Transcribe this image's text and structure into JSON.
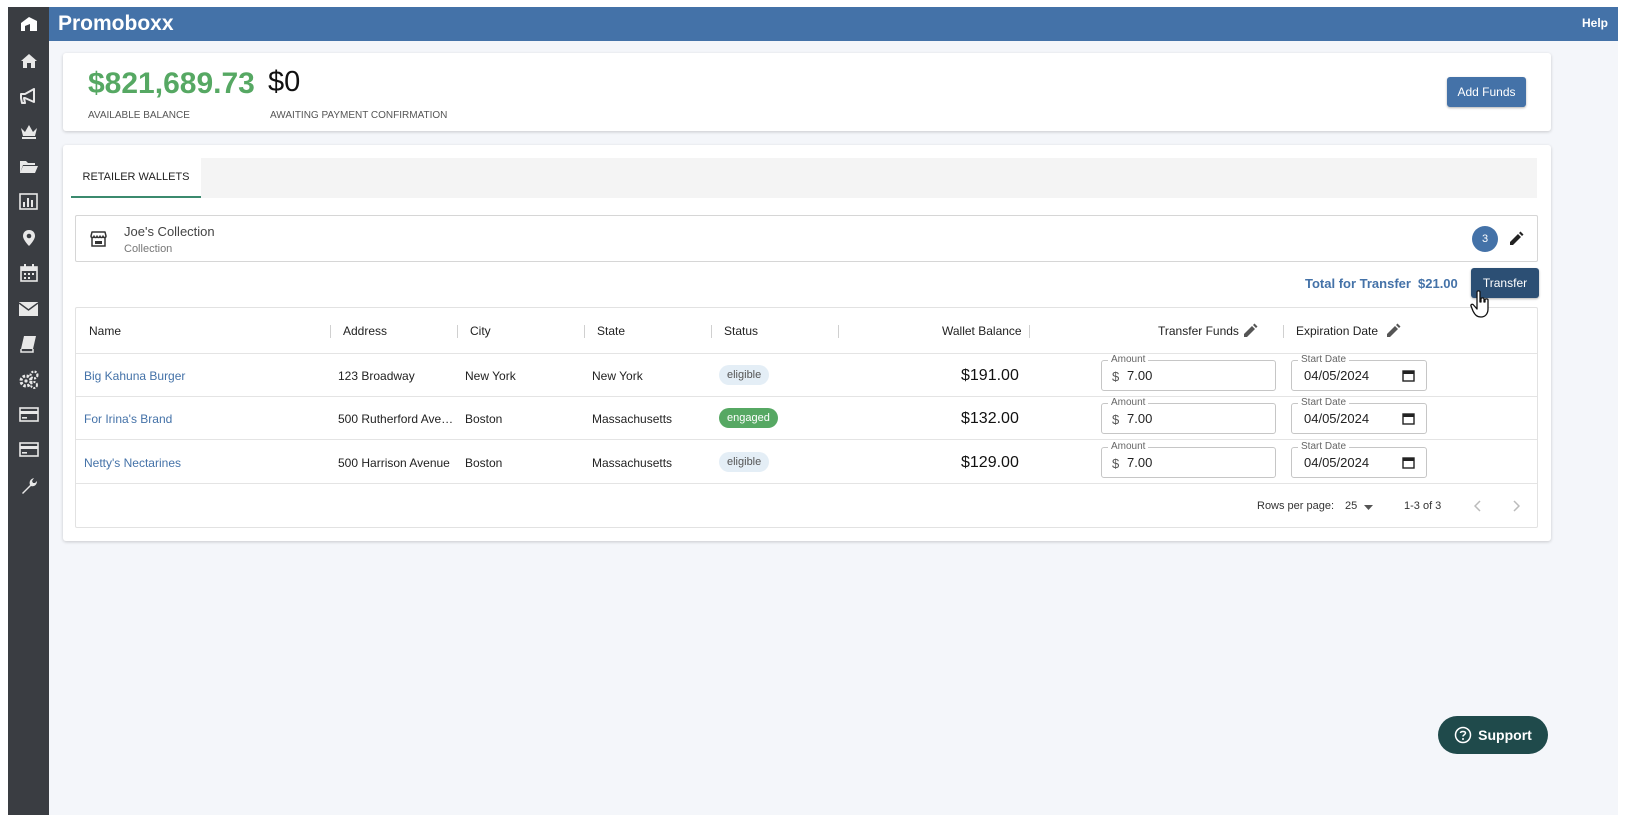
{
  "app": {
    "title": "Promoboxx",
    "help_label": "Help"
  },
  "sidebar": {
    "items": [
      {
        "icon": "home-icon"
      },
      {
        "icon": "megaphone-icon"
      },
      {
        "icon": "crown-icon"
      },
      {
        "icon": "folder-icon"
      },
      {
        "icon": "chart-icon"
      },
      {
        "icon": "map-pin-icon"
      },
      {
        "icon": "calendar-icon"
      },
      {
        "icon": "mail-icon"
      },
      {
        "icon": "book-icon"
      },
      {
        "icon": "gears-icon"
      },
      {
        "icon": "card-icon"
      },
      {
        "icon": "card-icon"
      },
      {
        "icon": "wrench-icon"
      }
    ]
  },
  "balance": {
    "available_amount": "$821,689.73",
    "available_label": "AVAILABLE BALANCE",
    "awaiting_amount": "$0",
    "awaiting_label": "AWAITING PAYMENT CONFIRMATION",
    "add_funds_label": "Add Funds"
  },
  "tabs": [
    {
      "label": "RETAILER WALLETS",
      "active": true
    }
  ],
  "retailer": {
    "name": "Joe's Collection",
    "type": "Collection",
    "count": "3"
  },
  "transfer": {
    "total_label": "Total for Transfer",
    "total_value": "$21.00",
    "button_label": "Transfer"
  },
  "table": {
    "columns": [
      "Name",
      "Address",
      "City",
      "State",
      "Status",
      "Wallet Balance",
      "Transfer Funds",
      "Expiration Date"
    ],
    "rows": [
      {
        "name": "Big Kahuna Burger",
        "address": "123 Broadway",
        "city": "New York",
        "state": "New York",
        "status": "eligible",
        "wallet": "$191.00",
        "amount_label": "Amount",
        "currency": "$",
        "amount": "7.00",
        "date_label": "Start Date",
        "date": "04/05/2024"
      },
      {
        "name": "For Irina's Brand",
        "address": "500 Rutherford Ave…",
        "city": "Boston",
        "state": "Massachusetts",
        "status": "engaged",
        "wallet": "$132.00",
        "amount_label": "Amount",
        "currency": "$",
        "amount": "7.00",
        "date_label": "Start Date",
        "date": "04/05/2024"
      },
      {
        "name": "Netty's Nectarines",
        "address": "500 Harrison Avenue",
        "city": "Boston",
        "state": "Massachusetts",
        "status": "eligible",
        "wallet": "$129.00",
        "amount_label": "Amount",
        "currency": "$",
        "amount": "7.00",
        "date_label": "Start Date",
        "date": "04/05/2024"
      }
    ]
  },
  "pagination": {
    "rows_per_page_label": "Rows per page:",
    "rows_per_page_value": "25",
    "range": "1-3 of 3"
  },
  "support": {
    "label": "Support"
  },
  "colors": {
    "brand": "#4472a8",
    "sidebar": "#3a3d42",
    "balance": "#56a863",
    "engaged": "#56a863",
    "transfer_button": "#2c4f74",
    "support": "#1f4a4b"
  }
}
